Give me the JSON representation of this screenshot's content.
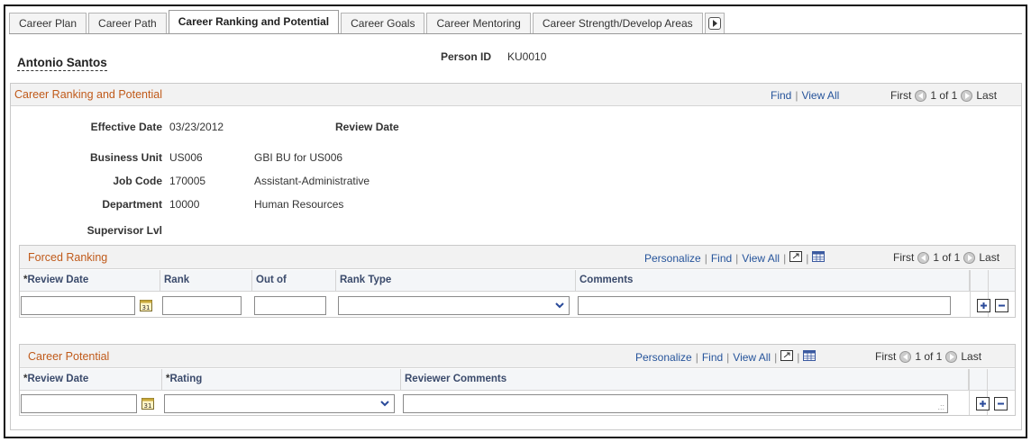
{
  "tabs": [
    {
      "label": "Career Plan"
    },
    {
      "label": "Career Path"
    },
    {
      "label": "Career Ranking and Potential"
    },
    {
      "label": "Career Goals"
    },
    {
      "label": "Career Mentoring"
    },
    {
      "label": "Career Strength/Develop Areas"
    }
  ],
  "person": {
    "name": "Antonio Santos",
    "id_label": "Person ID",
    "id_value": "KU0010"
  },
  "main": {
    "title": "Career Ranking and Potential",
    "find": "Find",
    "view_all": "View All",
    "first": "First",
    "count": "1 of 1",
    "last": "Last"
  },
  "fields": {
    "effective_date_label": "Effective Date",
    "effective_date_value": "03/23/2012",
    "review_date_label": "Review Date",
    "business_unit_label": "Business Unit",
    "business_unit_value": "US006",
    "business_unit_desc": "GBI BU for US006",
    "job_code_label": "Job Code",
    "job_code_value": "170005",
    "job_code_desc": "Assistant-Administrative",
    "department_label": "Department",
    "department_value": "10000",
    "department_desc": "Human Resources",
    "supervisor_lvl_label": "Supervisor Lvl"
  },
  "forced_ranking": {
    "title": "Forced Ranking",
    "personalize": "Personalize",
    "find": "Find",
    "view_all": "View All",
    "first": "First",
    "count": "1 of 1",
    "last": "Last",
    "columns": {
      "review_date": "Review Date",
      "rank": "Rank",
      "out_of": "Out of",
      "rank_type": "Rank Type",
      "comments": "Comments"
    }
  },
  "career_potential": {
    "title": "Career Potential",
    "personalize": "Personalize",
    "find": "Find",
    "view_all": "View All",
    "first": "First",
    "count": "1 of 1",
    "last": "Last",
    "columns": {
      "review_date": "Review Date",
      "rating": "Rating",
      "reviewer_comments": "Reviewer Comments"
    }
  }
}
